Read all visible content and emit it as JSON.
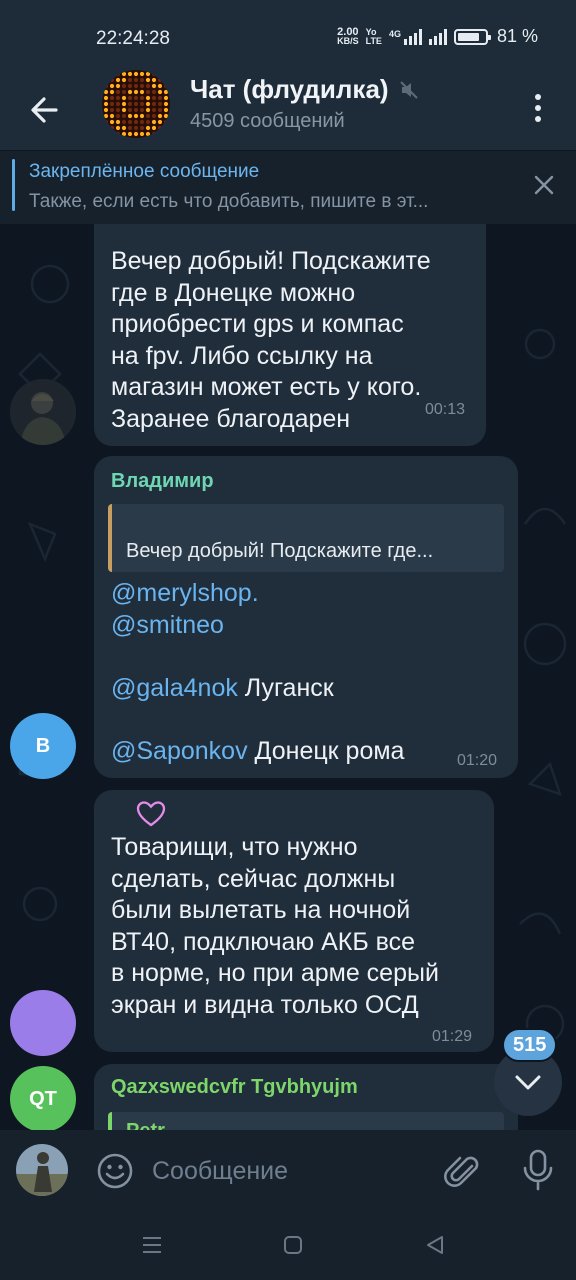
{
  "status_bar": {
    "time": "22:24:28",
    "net_speed": "2.00",
    "net_unit": "KB/S",
    "volte_top": "Yo",
    "volte_bottom": "LTE",
    "network_type": "4G",
    "battery": "81 %"
  },
  "header": {
    "title": "Чат (флудилка)",
    "subtitle": "4509 сообщений"
  },
  "pinned": {
    "title": "Закреплённое сообщение",
    "text": "Также, если есть что добавить, пишите в эт..."
  },
  "messages": [
    {
      "lines": [
        "Вечер добрый! Подскажите",
        "где в Донецке можно",
        "приобрести gps и компас",
        "на fpv. Либо ссылку на",
        "магазин может есть у кого.",
        "Заранее благодарен"
      ],
      "time": "00:13"
    },
    {
      "sender": "Владимир",
      "reply_quote": "Вечер добрый! Подскажите где...",
      "link_1": "@merylshop.",
      "link_2": "@smitneo",
      "link_3": "@gala4nok",
      "text_3": " Луганск",
      "link_4": "@Saponkov",
      "text_4": " Донецк рома",
      "avatar_letter": "В",
      "time": "01:20"
    },
    {
      "reaction": "♡",
      "lines": [
        "Товарищи, что нужно",
        "сделать, сейчас должны",
        "были вылетать на ночной",
        "ВТ40, подключаю АКБ все",
        "в норме, но при арме серый",
        "экран и видна только ОСД"
      ],
      "time": "01:29"
    },
    {
      "sender": "Qazxswedcvfr Tgvbhyujm",
      "reply_name": "Petr",
      "avatar_letters": "QT"
    }
  ],
  "unread_count": "515",
  "input": {
    "placeholder": "Сообщение"
  },
  "colors": {
    "accent": "#5ea4dc",
    "bubble": "#202d3b",
    "background": "#0e1621",
    "header": "#1e2c3a",
    "sender_vladimir": "#6fd6b3",
    "sender_qt": "#7dd66a",
    "reply_border": "#c89f62",
    "avatar_v": "#4aa6e8",
    "avatar_purple": "#9a7de8",
    "avatar_qt": "#57c25b"
  },
  "icons": [
    "back-arrow-icon",
    "muted-speaker-icon",
    "more-vertical-icon",
    "close-icon",
    "heart-icon",
    "chevron-down-icon",
    "emoji-icon",
    "attach-icon",
    "microphone-icon",
    "nav-menu-icon",
    "nav-home-icon",
    "nav-back-icon"
  ]
}
